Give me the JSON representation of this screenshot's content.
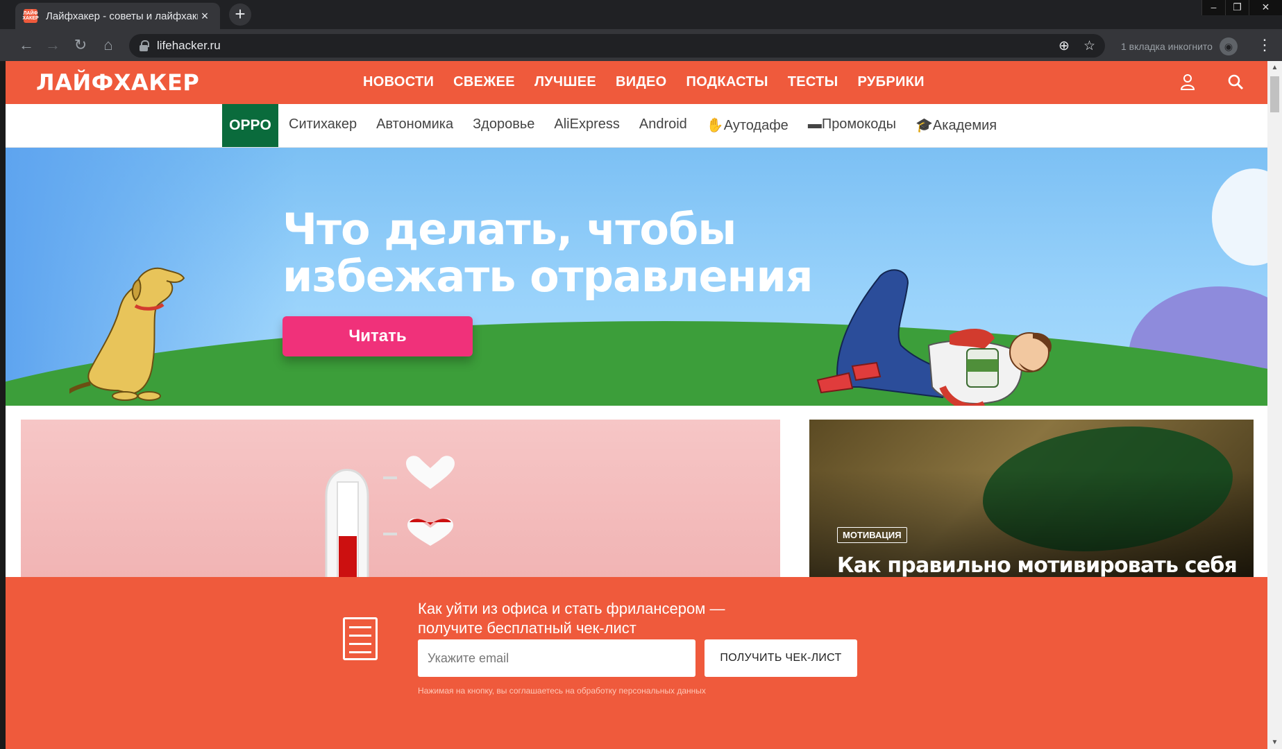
{
  "browser": {
    "tab_title": "Лайфхакер - советы и лайфхаки",
    "favicon_text": "ЛАЙФ ХАКЕР",
    "url": "lifehacker.ru",
    "incognito_label": "1 вкладка инкогнито"
  },
  "site": {
    "logo": "ЛАЙФХАКЕР",
    "main_nav": [
      "НОВОСТИ",
      "СВЕЖЕЕ",
      "ЛУЧШЕЕ",
      "ВИДЕО",
      "ПОДКАСТЫ",
      "ТЕСТЫ",
      "РУБРИКИ"
    ],
    "sub_nav": {
      "highlight": "OPPO",
      "items": [
        "Ситихакер",
        "Автономика",
        "Здоровье",
        "AliExpress",
        "Android",
        "✋Аутодафе",
        "▬Промокоды",
        "🎓Академия"
      ]
    }
  },
  "hero": {
    "title_line1": "Что делать, чтобы",
    "title_line2": "избежать отравления",
    "button": "Читать"
  },
  "cards": {
    "second": {
      "tag": "МОТИВАЦИЯ",
      "headline": "Как правильно мотивировать себя на финансовый успех"
    }
  },
  "banner": {
    "text_line1": "Как уйти из офиса и стать фрилансером —",
    "text_line2": "получите бесплатный чек-лист",
    "email_placeholder": "Укажите email",
    "button": "ПОЛУЧИТЬ ЧЕК-ЛИСТ",
    "note": "Нажимая на кнопку, вы соглашаетесь на обработку персональных данных"
  },
  "colors": {
    "brand": "#ef5a3c",
    "oppo": "#0a6b3c",
    "cta": "#f0317a"
  }
}
